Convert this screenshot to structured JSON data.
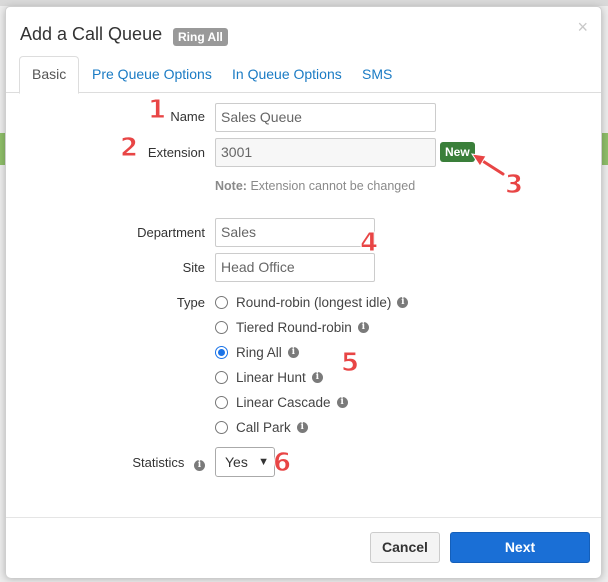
{
  "window": {
    "title": "Add a Call Queue",
    "type_badge": "Ring All",
    "close_label": "×"
  },
  "tabs": [
    {
      "label": "Basic",
      "active": true
    },
    {
      "label": "Pre Queue Options",
      "active": false
    },
    {
      "label": "In Queue Options",
      "active": false
    },
    {
      "label": "SMS",
      "active": false
    }
  ],
  "form": {
    "name_label": "Name",
    "name_value": "Sales Queue",
    "extension_label": "Extension",
    "extension_value": "3001",
    "new_badge": "New",
    "note_prefix": "Note:",
    "note_text": "Extension cannot be changed",
    "department_label": "Department",
    "department_value": "Sales",
    "site_label": "Site",
    "site_placeholder": "Head Office",
    "type_label": "Type",
    "type_options": [
      {
        "label": "Round-robin (longest idle)",
        "selected": false
      },
      {
        "label": "Tiered Round-robin",
        "selected": false
      },
      {
        "label": "Ring All",
        "selected": true
      },
      {
        "label": "Linear Hunt",
        "selected": false
      },
      {
        "label": "Linear Cascade",
        "selected": false
      },
      {
        "label": "Call Park",
        "selected": false
      }
    ],
    "statistics_label": "Statistics",
    "statistics_value": "Yes",
    "info_glyph": "i"
  },
  "footer": {
    "cancel_label": "Cancel",
    "next_label": "Next"
  },
  "annotations": [
    "1",
    "2",
    "3",
    "4",
    "5",
    "6"
  ],
  "colors": {
    "accent": "#1a6fd6",
    "tab_link": "#1a7bc4",
    "new_badge": "#3a7f3a",
    "annotation": "#e84545"
  }
}
